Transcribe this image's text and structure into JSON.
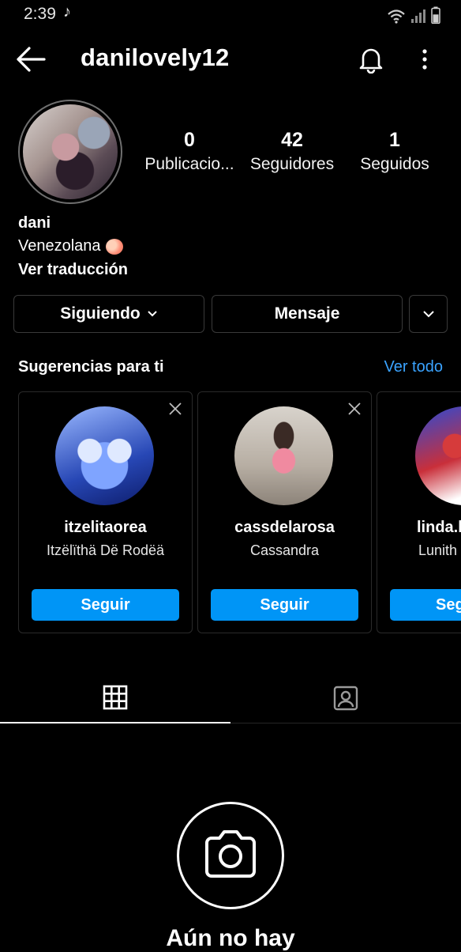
{
  "status_bar": {
    "time": "2:39",
    "battery_level": 0.6
  },
  "header": {
    "username": "danilovely12"
  },
  "stats": [
    {
      "value": "0",
      "label": "Publicacio..."
    },
    {
      "value": "42",
      "label": "Seguidores"
    },
    {
      "value": "1",
      "label": "Seguidos"
    }
  ],
  "bio": {
    "name": "dani",
    "text": "Venezolana",
    "translate": "Ver traducción"
  },
  "actions": {
    "following": "Siguiendo",
    "message": "Mensaje"
  },
  "suggestions": {
    "title": "Sugerencias para ti",
    "see_all": "Ver todo",
    "items": [
      {
        "handle": "itzelitaorea",
        "name": "Itzëlïthä Dë Rodëä",
        "button": "Seguir"
      },
      {
        "handle": "cassdelarosa",
        "name": "Cassandra",
        "button": "Seguir"
      },
      {
        "handle": "linda.l",
        "name": "Lunith",
        "button": "Seg"
      }
    ]
  },
  "empty_state": {
    "title": "Aún no hay"
  },
  "colors": {
    "accent": "#0095f6",
    "link": "#3aa3ff",
    "background": "#000000"
  }
}
